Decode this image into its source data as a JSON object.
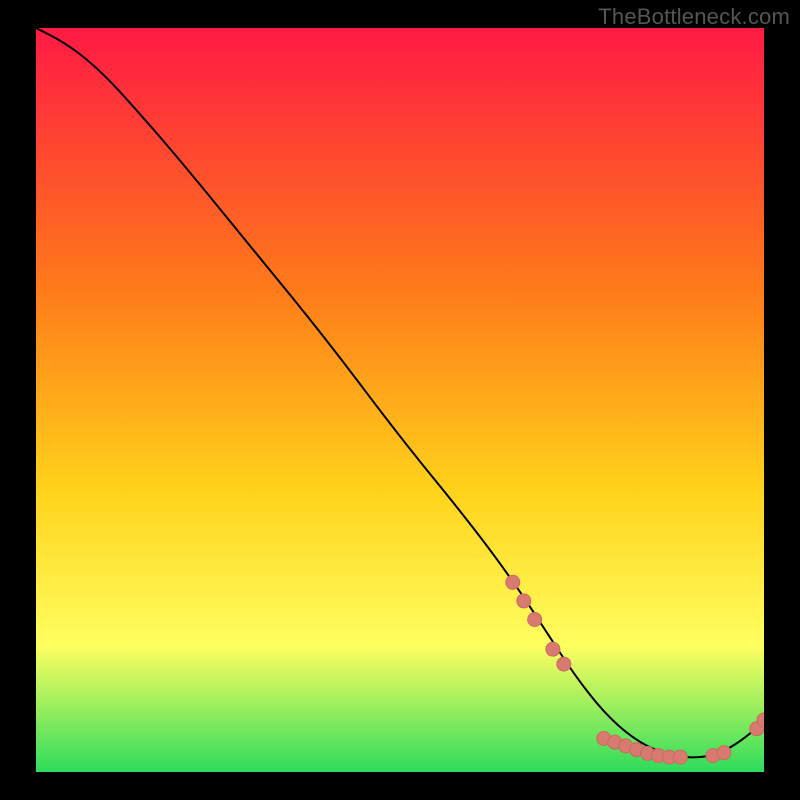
{
  "watermark": "TheBottleneck.com",
  "colors": {
    "background": "#000000",
    "gradient_top": "#ff1a44",
    "gradient_mid1": "#ff7a1a",
    "gradient_mid2": "#ffd21a",
    "gradient_mid3": "#ffff60",
    "gradient_bottom": "#2edc5c",
    "curve": "#000000",
    "marker_fill": "#d97a70",
    "marker_stroke": "#c96a60"
  },
  "chart_data": {
    "type": "line",
    "title": "",
    "xlabel": "",
    "ylabel": "",
    "xlim": [
      0,
      100
    ],
    "ylim": [
      0,
      100
    ],
    "grid": false,
    "legend": false,
    "series": [
      {
        "name": "curve",
        "x": [
          0,
          4,
          8,
          12,
          20,
          30,
          40,
          50,
          60,
          66,
          70,
          74,
          78,
          82,
          86,
          90,
          94,
          98,
          100
        ],
        "y": [
          100,
          98,
          95,
          91,
          82,
          70,
          58,
          45,
          33,
          25,
          19,
          13,
          8,
          4.5,
          2.5,
          1.8,
          2.4,
          5.0,
          7.0
        ]
      }
    ],
    "markers": [
      {
        "x": 65.5,
        "y": 25.5
      },
      {
        "x": 67.0,
        "y": 23.0
      },
      {
        "x": 68.5,
        "y": 20.5
      },
      {
        "x": 71.0,
        "y": 16.5
      },
      {
        "x": 72.5,
        "y": 14.5
      },
      {
        "x": 78.0,
        "y": 4.5
      },
      {
        "x": 79.5,
        "y": 4.0
      },
      {
        "x": 81.0,
        "y": 3.5
      },
      {
        "x": 82.5,
        "y": 3.0
      },
      {
        "x": 84.0,
        "y": 2.5
      },
      {
        "x": 85.5,
        "y": 2.2
      },
      {
        "x": 87.0,
        "y": 2.0
      },
      {
        "x": 88.5,
        "y": 2.0
      },
      {
        "x": 93.0,
        "y": 2.2
      },
      {
        "x": 94.5,
        "y": 2.6
      },
      {
        "x": 99.0,
        "y": 5.8
      },
      {
        "x": 100.0,
        "y": 7.0
      }
    ]
  }
}
